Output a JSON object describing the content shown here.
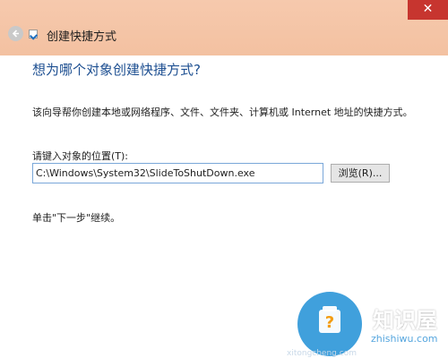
{
  "window": {
    "title": "创建快捷方式",
    "close_symbol": "✕"
  },
  "page": {
    "heading": "想为哪个对象创建快捷方式?",
    "description": "该向导帮你创建本地或网络程序、文件、文件夹、计算机或 Internet 地址的快捷方式。",
    "location_label": "请键入对象的位置(T):",
    "location_value": "C:\\Windows\\System32\\SlideToShutDown.exe",
    "browse_label": "浏览(R)...",
    "hint": "单击\"下一步\"继续。"
  },
  "watermark": {
    "brand": "知识屋",
    "domain": "zhishiwu.com",
    "faint_text": "xitongcheng.com",
    "color": "#1e8fd6"
  },
  "icons": {
    "back": "back-arrow-icon",
    "app": "shortcut-icon",
    "close": "close-icon"
  },
  "colors": {
    "titlebar": "#f3c1a1",
    "close_button": "#c7352f",
    "heading": "#1d4f91",
    "input_border": "#7aa7d9"
  }
}
